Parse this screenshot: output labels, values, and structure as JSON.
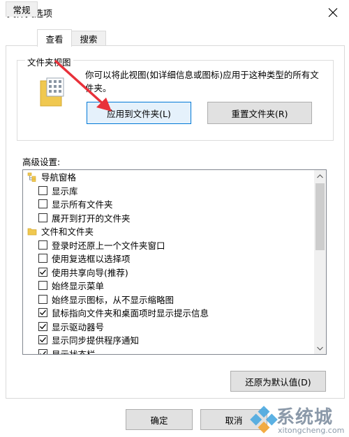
{
  "window": {
    "title": "文件夹选项"
  },
  "tabs": [
    {
      "label": "常规"
    },
    {
      "label": "查看"
    },
    {
      "label": "搜索"
    }
  ],
  "folder_view": {
    "group_title": "文件夹视图",
    "description": "你可以将此视图(如详细信息或图标)应用于这种类型的所有文件夹。",
    "apply_label": "应用到文件夹(L)",
    "reset_label": "重置文件夹(R)"
  },
  "advanced": {
    "label": "高级设置:",
    "items": [
      {
        "type": "category",
        "label": "导航窗格",
        "icon": "navigation-pane-icon"
      },
      {
        "type": "option",
        "label": "显示库",
        "checked": false
      },
      {
        "type": "option",
        "label": "显示所有文件夹",
        "checked": false
      },
      {
        "type": "option",
        "label": "展开到打开的文件夹",
        "checked": false
      },
      {
        "type": "category",
        "label": "文件和文件夹",
        "icon": "folder-icon"
      },
      {
        "type": "option",
        "label": "登录时还原上一个文件夹窗口",
        "checked": false
      },
      {
        "type": "option",
        "label": "使用复选框以选择项",
        "checked": false
      },
      {
        "type": "option",
        "label": "使用共享向导(推荐)",
        "checked": true
      },
      {
        "type": "option",
        "label": "始终显示菜单",
        "checked": false
      },
      {
        "type": "option",
        "label": "始终显示图标，从不显示缩略图",
        "checked": false
      },
      {
        "type": "option",
        "label": "鼠标指向文件夹和桌面项时显示提示信息",
        "checked": true
      },
      {
        "type": "option",
        "label": "显示驱动器号",
        "checked": true
      },
      {
        "type": "option",
        "label": "显示同步提供程序通知",
        "checked": true
      },
      {
        "type": "option",
        "label": "显示状态栏",
        "checked": true
      }
    ],
    "restore_label": "还原为默认值(D)"
  },
  "footer": {
    "ok_label": "确定",
    "cancel_label": "取消"
  },
  "watermark": {
    "text": "系统城",
    "url": "xitongcheng.com"
  },
  "colors": {
    "accent": "#0078d7",
    "annotation_arrow": "#e8313a",
    "folder_yellow": "#f0c850"
  }
}
